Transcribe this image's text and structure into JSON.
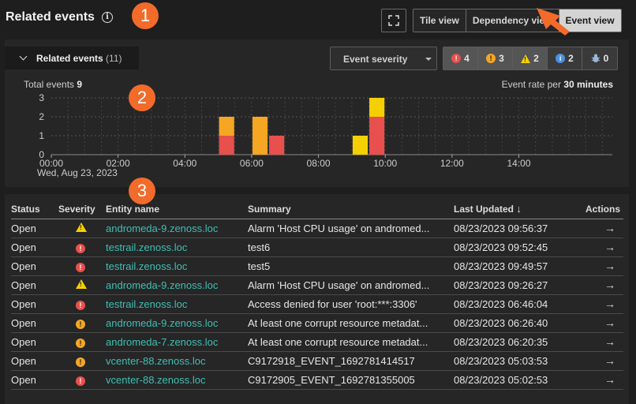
{
  "header": {
    "title": "Related events",
    "views": [
      "Tile view",
      "Dependency view",
      "Event view"
    ],
    "active_view": "Event view"
  },
  "callouts": [
    "1",
    "2",
    "3"
  ],
  "panel": {
    "related_label": "Related events",
    "related_count": "(11)",
    "severity_dropdown": "Event severity",
    "severity_counts": [
      {
        "icon": "critical-icon",
        "color": "#e8504d",
        "count": "4"
      },
      {
        "icon": "error-icon",
        "color": "#f5a623",
        "count": "3"
      },
      {
        "icon": "warning-icon",
        "color": "#f5d000",
        "count": "2"
      },
      {
        "icon": "info-icon",
        "color": "#4a90e2",
        "count": "2"
      },
      {
        "icon": "debug-icon",
        "color": "#9ab8d8",
        "count": "0"
      }
    ],
    "total_label": "Total events",
    "total_value": "9",
    "rate_label": "Event rate per",
    "rate_value": "30 minutes"
  },
  "chart_data": {
    "type": "bar",
    "stacked": true,
    "y_ticks": [
      "0",
      "1",
      "2",
      "3"
    ],
    "ylim": [
      0,
      3
    ],
    "x_ticks": [
      "00:00",
      "02:00",
      "04:00",
      "06:00",
      "08:00",
      "10:00",
      "12:00",
      "14:00"
    ],
    "x_date": "Wed, Aug 23, 2023",
    "grid": true,
    "bars": [
      {
        "time": "05:00",
        "segments": [
          {
            "color": "#e8504d",
            "value": 1
          },
          {
            "color": "#f5a623",
            "value": 1
          }
        ]
      },
      {
        "time": "06:00",
        "segments": [
          {
            "color": "#f5a623",
            "value": 2
          }
        ]
      },
      {
        "time": "06:30",
        "segments": [
          {
            "color": "#e8504d",
            "value": 1
          }
        ]
      },
      {
        "time": "09:00",
        "segments": [
          {
            "color": "#f5d000",
            "value": 1
          }
        ]
      },
      {
        "time": "09:30",
        "segments": [
          {
            "color": "#e8504d",
            "value": 2
          },
          {
            "color": "#f5d000",
            "value": 1
          }
        ]
      }
    ]
  },
  "table": {
    "columns": [
      "Status",
      "Severity",
      "Entity name",
      "Summary",
      "Last Updated",
      "Actions"
    ],
    "rows": [
      {
        "status": "Open",
        "severity": "warning",
        "entity": "andromeda-9.zenoss.loc",
        "summary": "Alarm 'Host CPU usage' on andromed...",
        "updated": "08/23/2023 09:56:37"
      },
      {
        "status": "Open",
        "severity": "critical",
        "entity": "testrail.zenoss.loc",
        "summary": "test6",
        "updated": "08/23/2023 09:52:45"
      },
      {
        "status": "Open",
        "severity": "critical",
        "entity": "testrail.zenoss.loc",
        "summary": "test5",
        "updated": "08/23/2023 09:49:57"
      },
      {
        "status": "Open",
        "severity": "warning",
        "entity": "andromeda-9.zenoss.loc",
        "summary": "Alarm 'Host CPU usage' on andromed...",
        "updated": "08/23/2023 09:26:27"
      },
      {
        "status": "Open",
        "severity": "critical",
        "entity": "testrail.zenoss.loc",
        "summary": "Access denied for user 'root:***:3306'",
        "updated": "08/23/2023 06:46:04"
      },
      {
        "status": "Open",
        "severity": "error",
        "entity": "andromeda-9.zenoss.loc",
        "summary": "At least one corrupt resource metadat...",
        "updated": "08/23/2023 06:26:40"
      },
      {
        "status": "Open",
        "severity": "error",
        "entity": "andromeda-7.zenoss.loc",
        "summary": "At least one corrupt resource metadat...",
        "updated": "08/23/2023 06:20:35"
      },
      {
        "status": "Open",
        "severity": "error",
        "entity": "vcenter-88.zenoss.loc",
        "summary": "C9172918_EVENT_1692781414517",
        "updated": "08/23/2023 05:03:53"
      },
      {
        "status": "Open",
        "severity": "critical",
        "entity": "vcenter-88.zenoss.loc",
        "summary": "C9172905_EVENT_1692781355005",
        "updated": "08/23/2023 05:02:53"
      }
    ]
  },
  "colors": {
    "critical": "#e8504d",
    "error": "#f5a623",
    "warning": "#f5d000",
    "info": "#4a90e2",
    "link": "#3fbfb3",
    "callout": "#f26b2a"
  }
}
